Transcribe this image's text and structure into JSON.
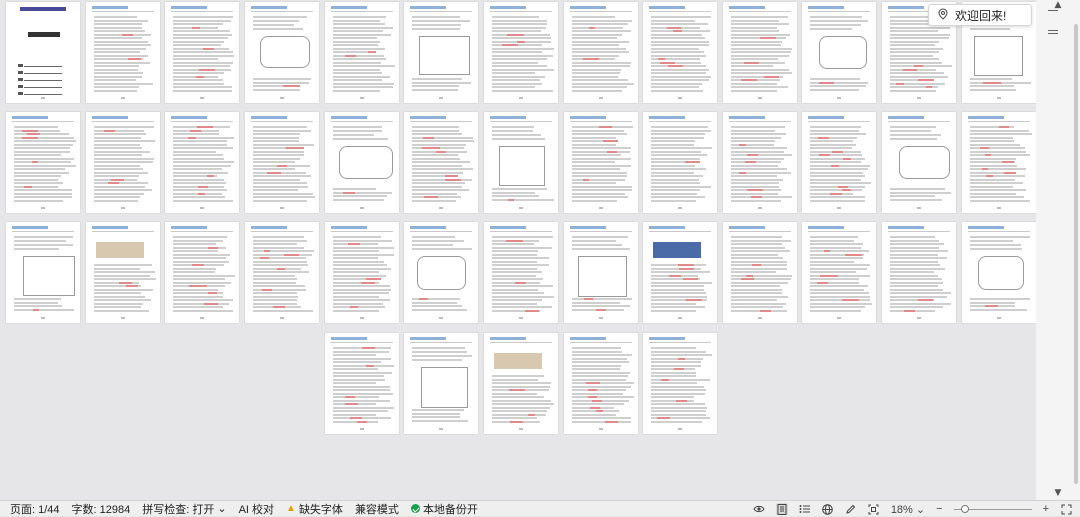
{
  "toast": {
    "text": "欢迎回来!",
    "icon": "location-pin-icon"
  },
  "document": {
    "total_pages": 44,
    "visible_pages": 44
  },
  "statusbar": {
    "page": "页面: 1/44",
    "word_count": "字数: 12984",
    "spell_check": "拼写检查: 打开",
    "spell_check_caret": "⌄",
    "ai_check": "AI 校对",
    "missing_fonts": "缺失字体",
    "compat_mode": "兼容模式",
    "local_backup": "本地备份开",
    "zoom": "18%",
    "zoom_caret": "⌄",
    "zoom_minus": "−",
    "zoom_plus": "+",
    "zoom_level": 0.1
  },
  "scrollbar": {
    "up": "▲",
    "down": "▼"
  },
  "colors": {
    "page_bg": "#e6e6e8",
    "accent_header": "#8fb0d8",
    "backup_green": "#1aa04a",
    "warning": "#e0a000"
  }
}
